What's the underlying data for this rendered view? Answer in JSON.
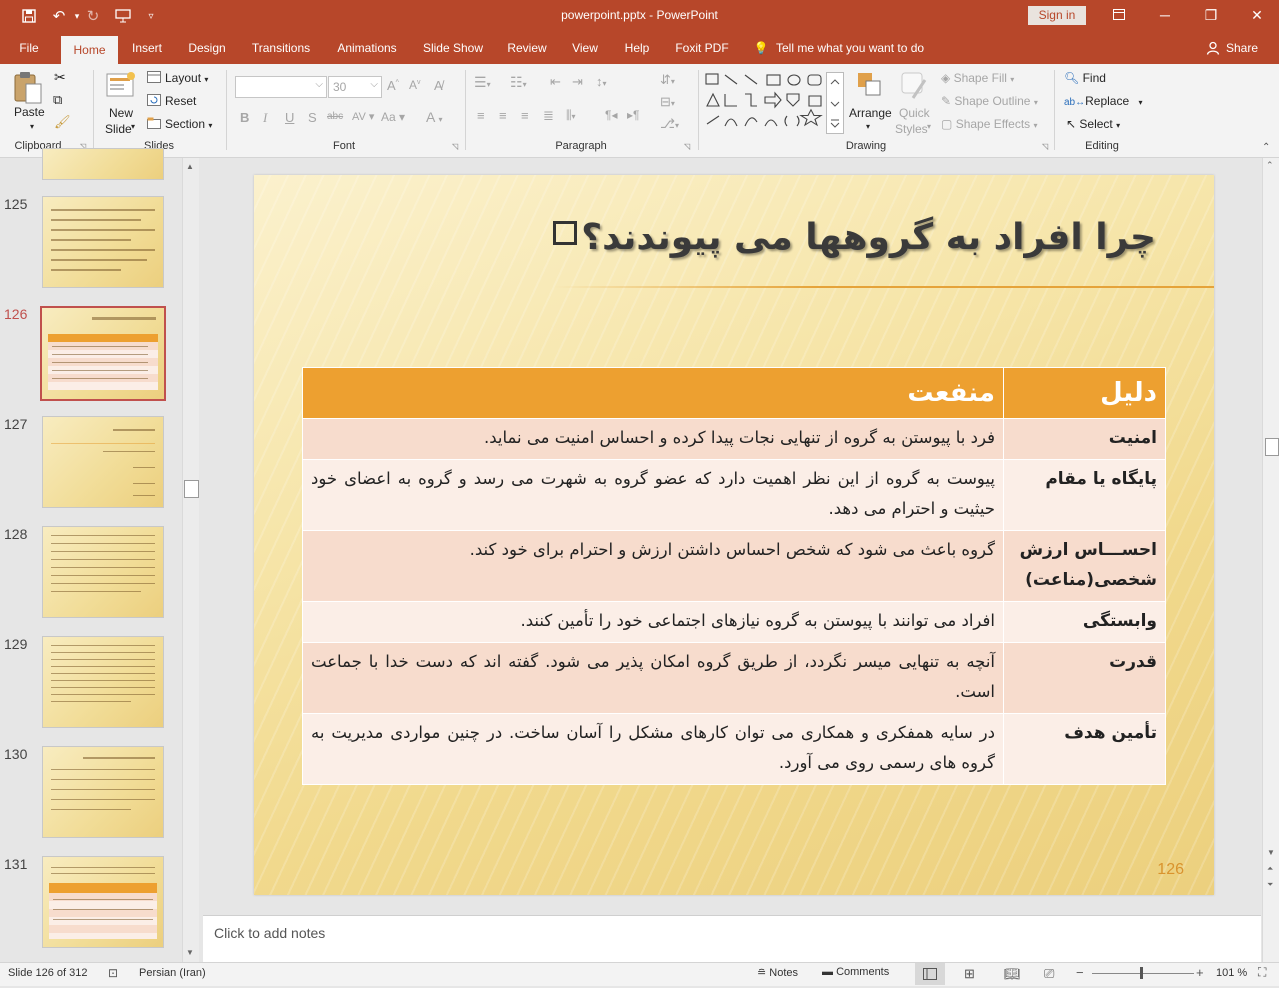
{
  "window": {
    "file_title": "powerpoint.pptx  -  PowerPoint",
    "sign_in": "Sign in",
    "share": "Share",
    "tell_me": "Tell me what you want to do"
  },
  "tabs": [
    "File",
    "Home",
    "Insert",
    "Design",
    "Transitions",
    "Animations",
    "Slide Show",
    "Review",
    "View",
    "Help",
    "Foxit PDF"
  ],
  "active_tab": "Home",
  "ribbon": {
    "clipboard": {
      "label": "Clipboard",
      "paste": "Paste"
    },
    "slides": {
      "label": "Slides",
      "new_slide_1": "New",
      "new_slide_2": "Slide",
      "layout": "Layout",
      "reset": "Reset",
      "section": "Section"
    },
    "font": {
      "label": "Font",
      "size": "30"
    },
    "paragraph": {
      "label": "Paragraph"
    },
    "drawing": {
      "label": "Drawing",
      "arrange": "Arrange",
      "quick_styles_1": "Quick",
      "quick_styles_2": "Styles",
      "shape_fill": "Shape Fill",
      "shape_outline": "Shape Outline",
      "shape_effects": "Shape Effects"
    },
    "editing": {
      "label": "Editing",
      "find": "Find",
      "replace": "Replace",
      "select": "Select"
    }
  },
  "thumbnails": [
    "125",
    "126",
    "127",
    "128",
    "129",
    "130",
    "131"
  ],
  "current_slide": "126",
  "slide": {
    "title": "چرا افراد به گروهها می پیوندند؟",
    "table": {
      "headers": [
        "دلیل",
        "منفعت"
      ],
      "rows": [
        {
          "reason": "امنیت",
          "benefit": "فرد با پیوستن به گروه از تنهایی نجات پیدا کرده و احساس امنیت می نماید."
        },
        {
          "reason": "پایگاه یا مقام",
          "benefit": "پیوست به گروه از این نظر اهمیت دارد که عضو گروه به شهرت می رسد و گروه به اعضای خود حیثیت و احترام می دهد."
        },
        {
          "reason": "احســـاس ارزش شخصی(مناعت)",
          "benefit": "گروه باعث می شود که شخص احساس داشتن ارزش و احترام برای خود کند."
        },
        {
          "reason": "وابستگی",
          "benefit": "افراد می توانند با پیوستن به گروه نیازهای اجتماعی خود را تأمین کنند."
        },
        {
          "reason": "قدرت",
          "benefit": "آنچه به تنهایی میسر نگردد، از طریق گروه امکان پذیر می شود. گفته اند که دست خدا با جماعت است."
        },
        {
          "reason": "تأمین هدف",
          "benefit": "در سایه همفکری و همکاری می توان کارهای مشکل را آسان ساخت. در چنین مواردی مدیریت به گروه های رسمی روی می آورد."
        }
      ]
    },
    "number": "126"
  },
  "notes_placeholder": "Click to add notes",
  "status": {
    "slide_of": "Slide 126 of 312",
    "language": "Persian (Iran)",
    "notes": "Notes",
    "comments": "Comments",
    "zoom": "101 %"
  },
  "colors": {
    "accent": "#b7472a",
    "table_header": "#eda030",
    "row_odd": "#f7dccd",
    "row_even": "#fbeee7"
  }
}
